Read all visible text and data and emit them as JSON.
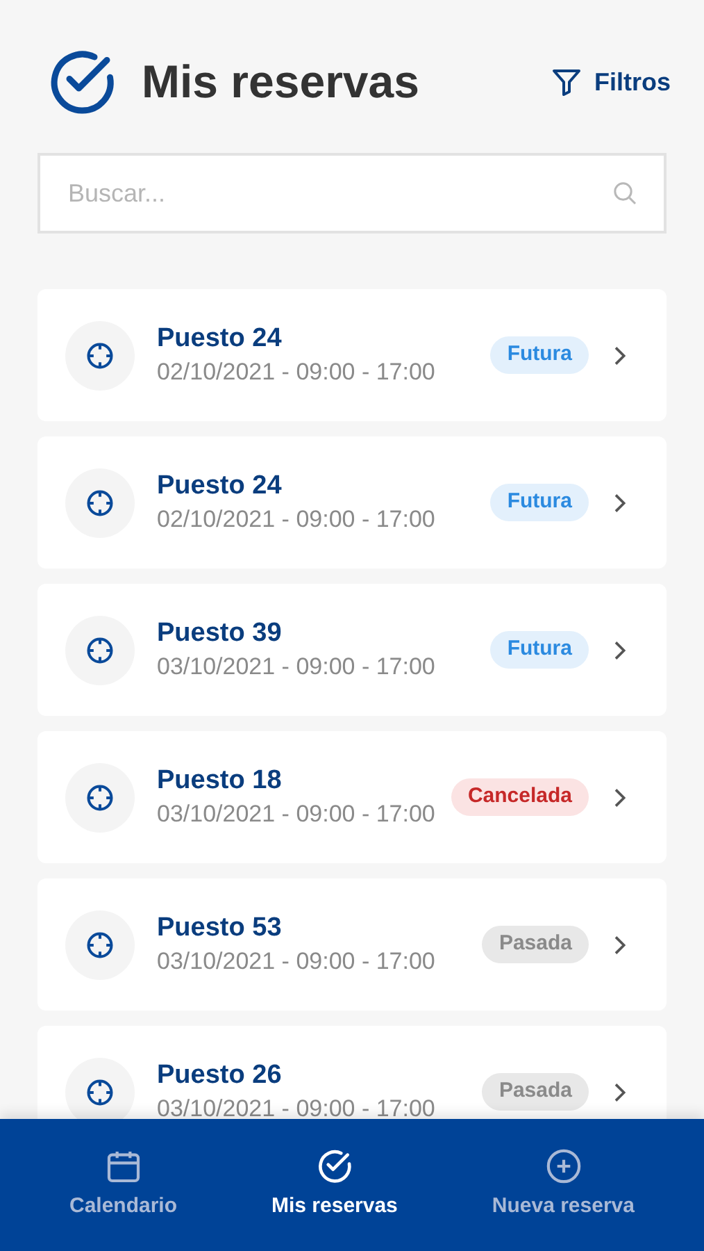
{
  "header": {
    "title": "Mis reservas",
    "filter_label": "Filtros"
  },
  "search": {
    "placeholder": "Buscar..."
  },
  "reservations": [
    {
      "title": "Puesto 24",
      "datetime": "02/10/2021 - 09:00 - 17:00",
      "status": "Futura",
      "kind": "future"
    },
    {
      "title": "Puesto 24",
      "datetime": "02/10/2021 - 09:00 - 17:00",
      "status": "Futura",
      "kind": "future"
    },
    {
      "title": "Puesto 39",
      "datetime": "03/10/2021 - 09:00 - 17:00",
      "status": "Futura",
      "kind": "future"
    },
    {
      "title": "Puesto 18",
      "datetime": "03/10/2021 - 09:00 - 17:00",
      "status": "Cancelada",
      "kind": "cancelled"
    },
    {
      "title": "Puesto 53",
      "datetime": "03/10/2021 - 09:00 - 17:00",
      "status": "Pasada",
      "kind": "past"
    },
    {
      "title": "Puesto 26",
      "datetime": "03/10/2021 - 09:00 - 17:00",
      "status": "Pasada",
      "kind": "past"
    }
  ],
  "bottom_nav": [
    {
      "label": "Calendario",
      "kind": "calendar",
      "selected": false
    },
    {
      "label": "Mis reservas",
      "kind": "check",
      "selected": true
    },
    {
      "label": "Nueva reserva",
      "kind": "plus",
      "selected": false
    }
  ]
}
